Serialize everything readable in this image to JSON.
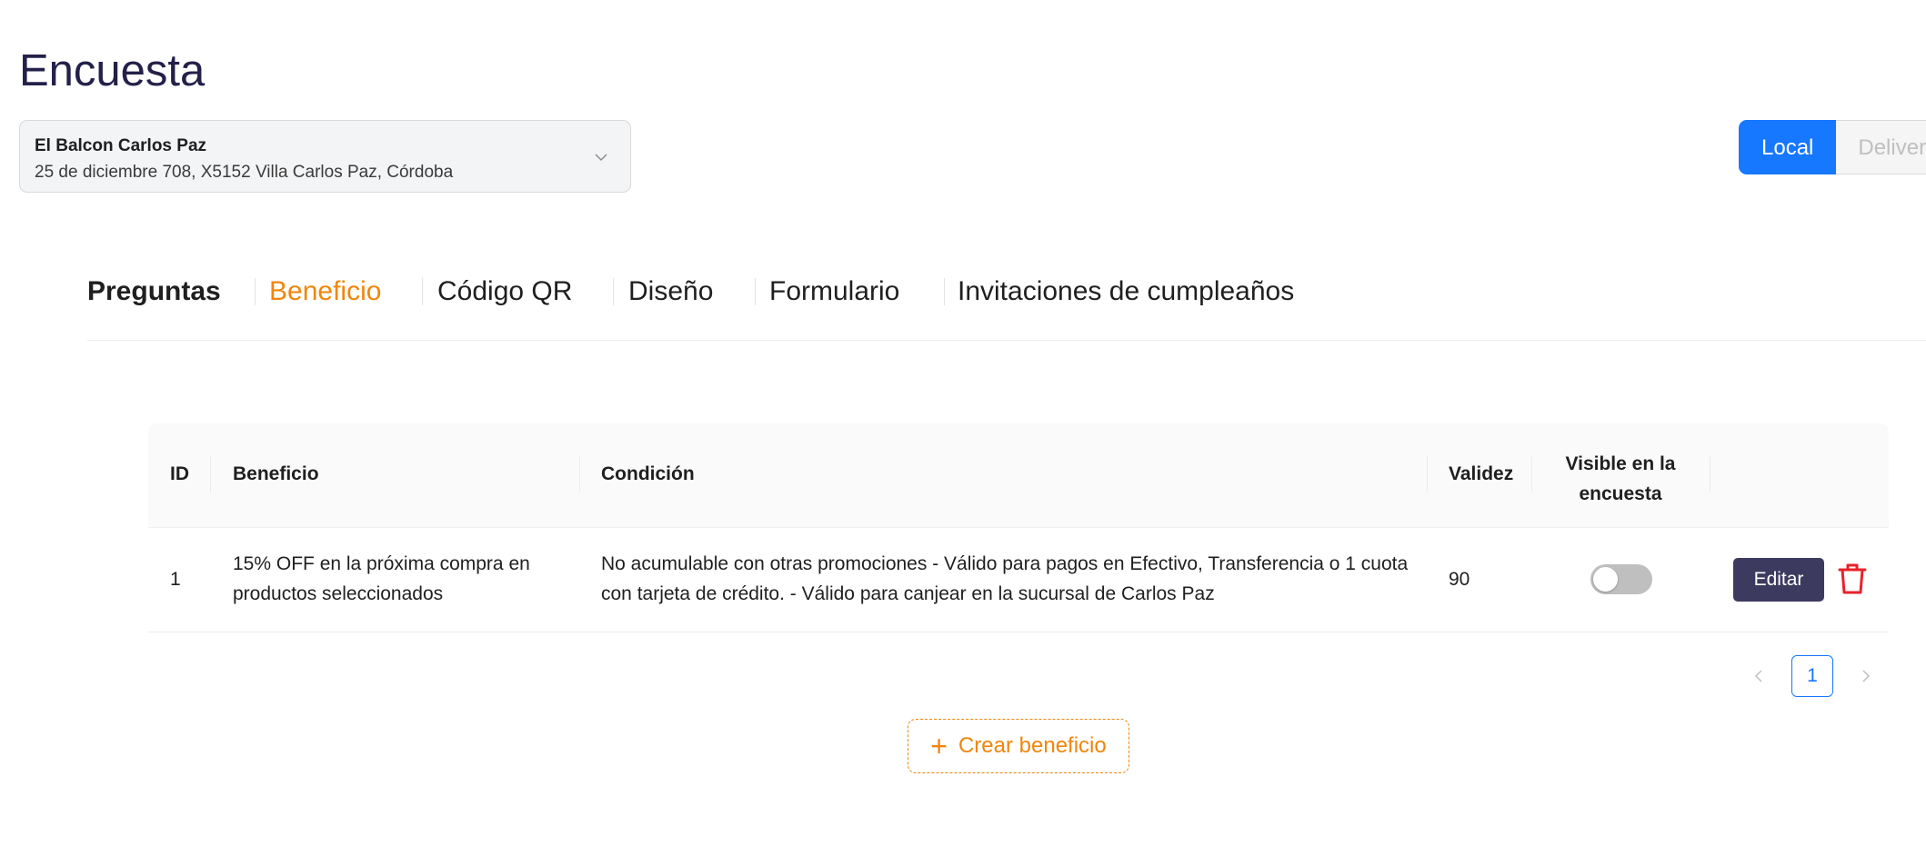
{
  "page": {
    "title": "Encuesta"
  },
  "store_select": {
    "name": "El Balcon Carlos Paz",
    "address": "25 de diciembre 708, X5152 Villa Carlos Paz, Córdoba",
    "icon": "chevron-down-icon"
  },
  "mode_toggle": {
    "options": [
      {
        "label": "Local",
        "active": true
      },
      {
        "label": "Delivery",
        "active": false
      }
    ],
    "accent": "#1677ff"
  },
  "tabs": [
    {
      "label": "Preguntas"
    },
    {
      "label": "Beneficio",
      "active": true
    },
    {
      "label": "Código QR"
    },
    {
      "label": "Diseño"
    },
    {
      "label": "Formulario"
    },
    {
      "label": "Invitaciones de cumpleaños"
    }
  ],
  "table": {
    "headers": {
      "id": "ID",
      "benefit": "Beneficio",
      "condition": "Condición",
      "validity": "Validez",
      "visible_line1": "Visible en la",
      "visible_line2": "encuesta"
    },
    "rows": [
      {
        "id": "1",
        "benefit_line1": "15% OFF en la próxima compra en",
        "benefit_line2": "productos seleccionados",
        "condition_line1": "No acumulable con otras promociones - Válido para pagos en Efectivo, Transferencia o 1 cuota",
        "condition_line2": "con tarjeta de crédito. - Válido para canjear en la sucursal de Carlos Paz",
        "validity": "90",
        "visible": false,
        "edit_label": "Editar",
        "delete_icon": "trash-icon"
      }
    ]
  },
  "pagination": {
    "current": "1",
    "prev_icon": "chevron-left-icon",
    "next_icon": "chevron-right-icon"
  },
  "create_button": {
    "label": "Crear beneficio",
    "icon": "plus-icon",
    "color": "#f0860c"
  },
  "colors": {
    "title": "#23214a",
    "active_tab": "#f0860c",
    "edit_button": "#3d3a5f",
    "delete": "#e8222a"
  }
}
